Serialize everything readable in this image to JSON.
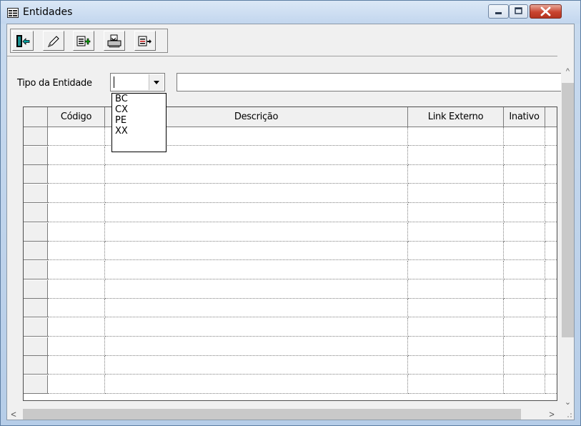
{
  "window": {
    "title": "Entidades",
    "icon": "form-icon"
  },
  "title_buttons": [
    {
      "name": "minimize-icon"
    },
    {
      "name": "maximize-icon"
    },
    {
      "name": "close-icon"
    }
  ],
  "toolbar": {
    "buttons": [
      {
        "name": "exit-door-icon"
      },
      {
        "name": "edit-pencil-icon"
      },
      {
        "name": "add-record-icon"
      },
      {
        "name": "print-icon"
      },
      {
        "name": "export-icon"
      }
    ]
  },
  "filter": {
    "label": "Tipo da Entidade",
    "combo_value": "",
    "description_value": "",
    "options": [
      "BC",
      "CX",
      "PE",
      "XX"
    ]
  },
  "grid": {
    "columns": [
      "",
      "Código",
      "Descrição",
      "Link Externo",
      "Inativo",
      ""
    ],
    "row_count": 14
  },
  "scrollbars": {
    "up": "^",
    "down": "⌄",
    "left": "<",
    "right": ">"
  }
}
